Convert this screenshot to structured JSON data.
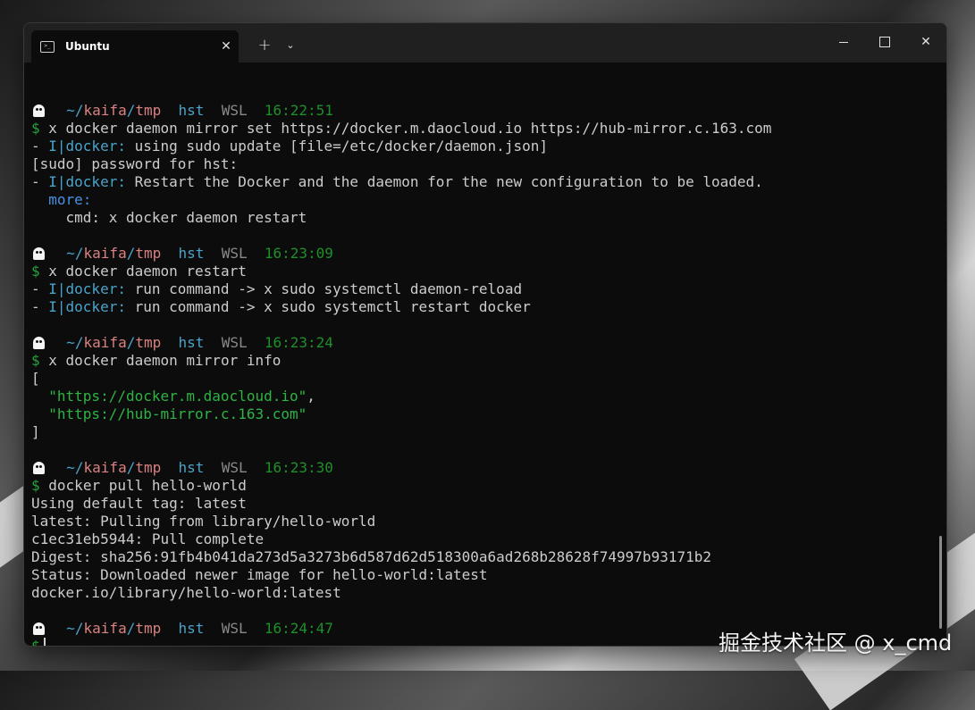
{
  "window": {
    "tab_title": "Ubuntu",
    "tab_icon": "terminal-icon",
    "new_tab": "+",
    "dropdown": "⌄",
    "controls": {
      "minimize": "minimize-icon",
      "maximize": "maximize-icon",
      "close": "✕"
    }
  },
  "blocks": [
    {
      "prompt": {
        "tilde": "~/",
        "seg1": "kaifa",
        "slash": "/",
        "seg2": "tmp",
        "user": "hst",
        "host": "WSL",
        "time": "16:22:51"
      },
      "command": "x docker daemon mirror set https://docker.m.daocloud.io https://hub-mirror.c.163.com",
      "output": [
        {
          "dash": "- ",
          "tag": "I|docker:",
          "text": " using sudo update [file=/etc/docker/daemon.json]"
        },
        {
          "text": "[sudo] password for hst:"
        },
        {
          "dash": "- ",
          "tag": "I|docker:",
          "text": " Restart the Docker and the daemon for the new configuration to be loaded."
        },
        {
          "more": "  more:"
        },
        {
          "text": "    cmd: x docker daemon restart"
        }
      ]
    },
    {
      "prompt": {
        "tilde": "~/",
        "seg1": "kaifa",
        "slash": "/",
        "seg2": "tmp",
        "user": "hst",
        "host": "WSL",
        "time": "16:23:09"
      },
      "command": "x docker daemon restart",
      "output": [
        {
          "dash": "- ",
          "tag": "I|docker:",
          "text": " run command -> x sudo systemctl daemon-reload"
        },
        {
          "dash": "- ",
          "tag": "I|docker:",
          "text": " run command -> x sudo systemctl restart docker"
        }
      ]
    },
    {
      "prompt": {
        "tilde": "~/",
        "seg1": "kaifa",
        "slash": "/",
        "seg2": "tmp",
        "user": "hst",
        "host": "WSL",
        "time": "16:23:24"
      },
      "command": "x docker daemon mirror info",
      "output": [
        {
          "text": "["
        },
        {
          "indent": "  ",
          "str": "\"https://docker.m.daocloud.io\"",
          "text": ","
        },
        {
          "indent": "  ",
          "str": "\"https://hub-mirror.c.163.com\""
        },
        {
          "text": "]"
        }
      ]
    },
    {
      "prompt": {
        "tilde": "~/",
        "seg1": "kaifa",
        "slash": "/",
        "seg2": "tmp",
        "user": "hst",
        "host": "WSL",
        "time": "16:23:30"
      },
      "command": "docker pull hello-world",
      "output": [
        {
          "text": "Using default tag: latest"
        },
        {
          "text": "latest: Pulling from library/hello-world"
        },
        {
          "text": "c1ec31eb5944: Pull complete"
        },
        {
          "text": "Digest: sha256:91fb4b041da273d5a3273b6d587d62d518300a6ad268b28628f74997b93171b2"
        },
        {
          "text": "Status: Downloaded newer image for hello-world:latest"
        },
        {
          "text": "docker.io/library/hello-world:latest"
        }
      ]
    }
  ],
  "current_prompt": {
    "tilde": "~/",
    "seg1": "kaifa",
    "slash": "/",
    "seg2": "tmp",
    "user": "hst",
    "host": "WSL",
    "time": "16:24:47"
  },
  "dollar": "$",
  "watermark": "掘金技术社区 @ x_cmd"
}
